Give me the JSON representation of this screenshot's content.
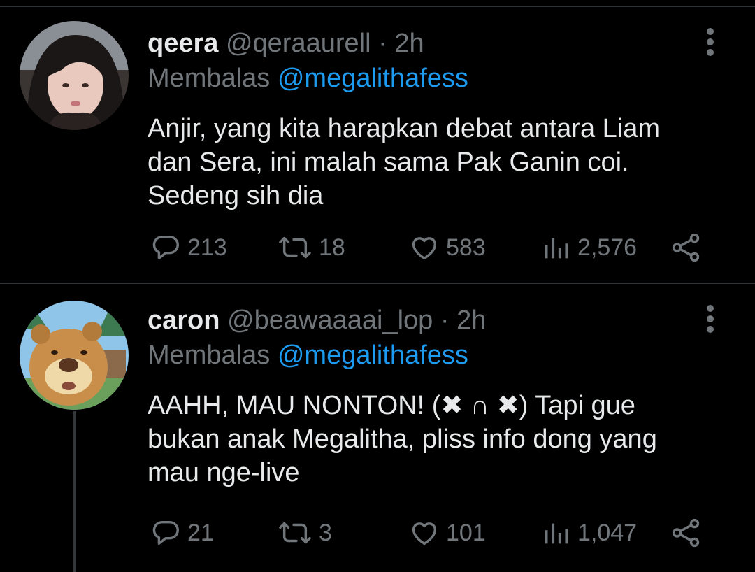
{
  "tweets": [
    {
      "name": "qeera",
      "handle": "@qeraaurell",
      "dot": "·",
      "time": "2h",
      "reply_prefix": "Membalas",
      "reply_to": "@megalithafess",
      "body_lines": [
        "Anjir, yang kita harapkan debat antara Liam",
        "dan Sera, ini malah sama Pak Ganin coi.",
        "Sedeng sih dia"
      ],
      "replies": "213",
      "retweets": "18",
      "likes": "583",
      "views": "2,576"
    },
    {
      "name": "caron",
      "handle": "@beawaaaai_lop",
      "dot": "·",
      "time": "2h",
      "reply_prefix": "Membalas",
      "reply_to": "@megalithafess",
      "body_line1_a": "AAHH, MAU NONTON! (",
      "body_line1_b": "✖ ∩ ✖",
      "body_line1_c": ") Tapi gue",
      "body_line2": "bukan anak Megalitha, pliss info dong yang",
      "body_line3": "mau nge-live",
      "replies": "21",
      "retweets": "3",
      "likes": "101",
      "views": "1,047"
    }
  ],
  "icons": {
    "reply": "reply-icon",
    "retweet": "retweet-icon",
    "like": "heart-icon",
    "views": "views-icon",
    "share": "share-icon",
    "more": "more-vertical-icon"
  },
  "colors": {
    "background": "#000000",
    "text": "#e7e9ea",
    "muted": "#71767b",
    "mention": "#1d9bf0",
    "divider": "#2f3336"
  }
}
